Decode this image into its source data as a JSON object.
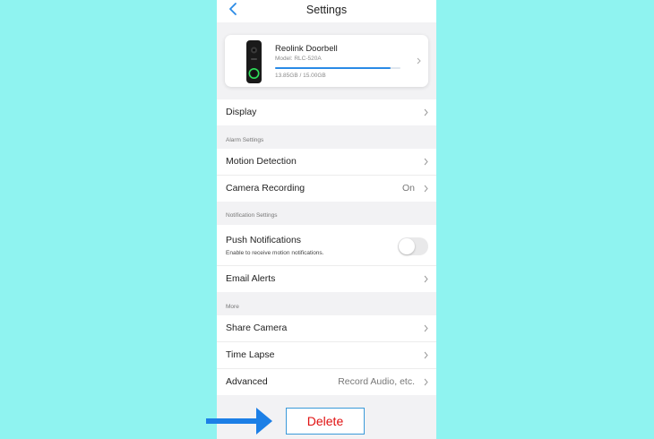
{
  "header": {
    "title": "Settings",
    "back_icon": "chevron-left-icon"
  },
  "device": {
    "name": "Reolink Doorbell",
    "model": "Model: RLC-520A",
    "storage": "13.85GB / 15.00GB",
    "storage_fraction": 0.92,
    "accent_color": "#2a8ae6"
  },
  "display": {
    "label": "Display"
  },
  "alarm_settings": {
    "header": "Alarm Settings",
    "motion_detection": {
      "label": "Motion Detection"
    },
    "camera_recording": {
      "label": "Camera Recording",
      "value": "On"
    }
  },
  "notification_settings": {
    "header": "Notification Settings",
    "push_notifications": {
      "label": "Push Notifications",
      "subtitle": "Enable to receive motion notifications.",
      "enabled": false
    },
    "email_alerts": {
      "label": "Email Alerts"
    }
  },
  "more": {
    "header": "More",
    "share_camera": {
      "label": "Share Camera"
    },
    "time_lapse": {
      "label": "Time Lapse"
    },
    "advanced": {
      "label": "Advanced",
      "value": "Record Audio, etc."
    }
  },
  "delete_button": {
    "label": "Delete",
    "text_color": "#e01010",
    "border_color": "#3a9ad9"
  },
  "annotation": {
    "arrow_icon": "arrow-right-icon",
    "arrow_color": "#1c7fe6"
  },
  "colors": {
    "background": "#8ff3f0",
    "panel": "#f2f2f4"
  }
}
